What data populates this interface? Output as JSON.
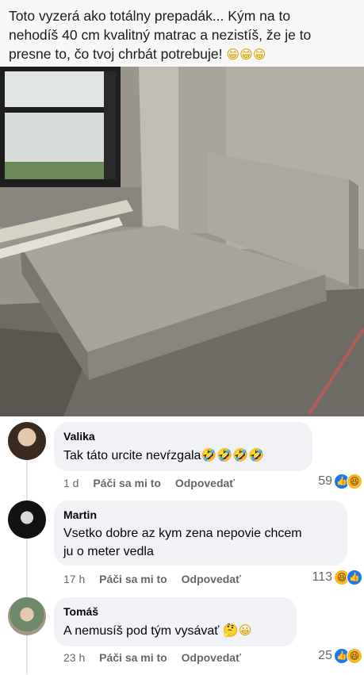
{
  "post": {
    "text_line1": "Toto vyzerá ako totálny prepadák... Kým na to",
    "text_line2": "nehodíš 40 cm kvalitný matrac a nezistíš, že je to",
    "text_line3": "presne to, čo tvoj chrbát potrebuje!",
    "emoji": "😁😁😁"
  },
  "photo": {
    "icon": "concrete-bed-photo"
  },
  "actions": {
    "like": "Páči sa mi to",
    "reply": "Odpovedať"
  },
  "comments": [
    {
      "author": "Valika",
      "text": "Tak táto urcite nevŕzgala",
      "emoji": "🤣🤣🤣🤣",
      "time": "1 d",
      "reaction_count": "59",
      "reactions": [
        "like-icon",
        "haha-icon"
      ]
    },
    {
      "author": "Martin",
      "text_line1": "Vsetko dobre az kym zena nepovie chcem",
      "text_line2": "ju o meter vedla",
      "time": "17 h",
      "reaction_count": "113",
      "reactions": [
        "haha-icon",
        "like-icon"
      ]
    },
    {
      "author": "Tomáš",
      "text": "A nemusíš pod tým vysávať",
      "emoji": "🤔😀",
      "time": "23 h",
      "reaction_count": "25",
      "reactions": [
        "like-icon",
        "haha-icon"
      ]
    }
  ]
}
